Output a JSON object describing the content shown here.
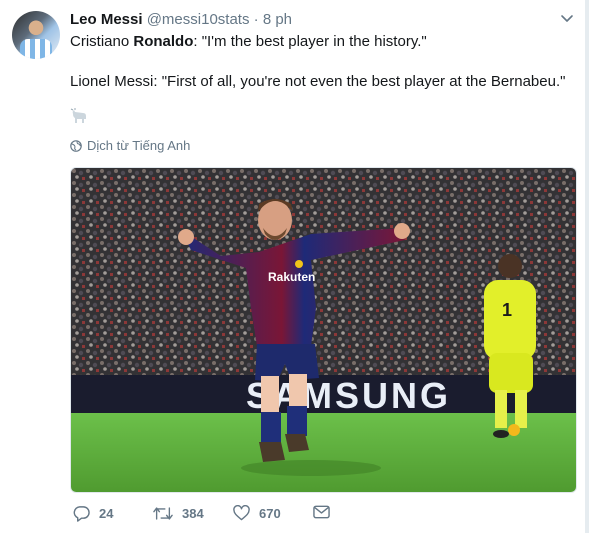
{
  "author": {
    "name": "Leo Messi",
    "handle": "@messi10stats",
    "separator": "·",
    "time": "8 ph"
  },
  "tweet": {
    "line1_a": "Cristiano ",
    "line1_bold": "Ronaldo",
    "line1_b": ": \"I'm the best player in the history.\"",
    "line2": "Lionel Messi: \"First of all, you're not even the best player at the Bernabeu.\""
  },
  "translate_label": "Dịch từ Tiếng Anh",
  "photo": {
    "jersey_sponsor": "Rakuten",
    "ad_board_text": "SAMSUNG",
    "keeper_number": "1"
  },
  "actions": {
    "replies": "24",
    "retweets": "384",
    "likes": "670"
  },
  "icons": [
    "chevron-down-icon",
    "goat-emoji-icon",
    "globe-icon",
    "reply-icon",
    "retweet-icon",
    "like-icon",
    "message-icon"
  ]
}
